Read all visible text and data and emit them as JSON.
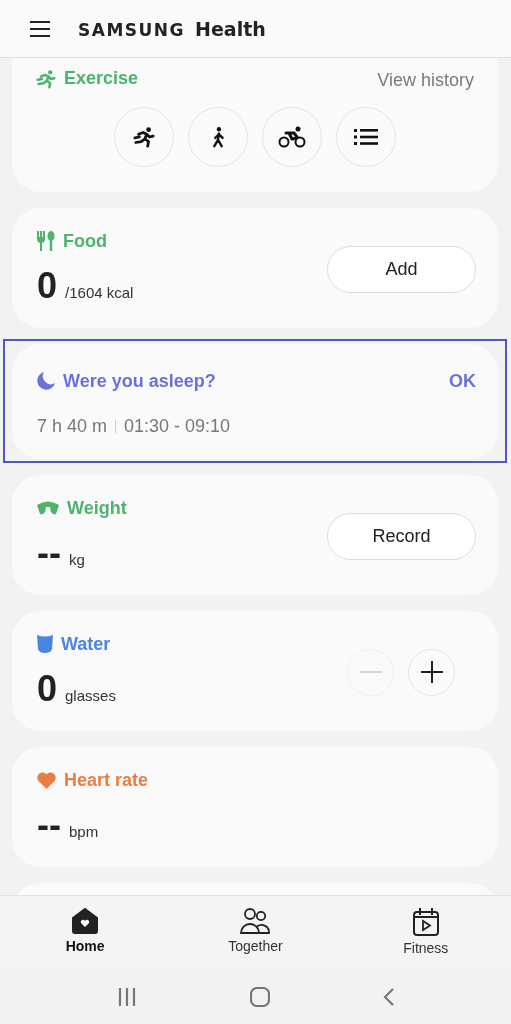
{
  "header": {
    "brand": "SAMSUNG",
    "app": "Health"
  },
  "cards": [
    {
      "kind": "exercise",
      "title": "Exercise",
      "color": "#4cb46c",
      "action": "View history"
    },
    {
      "kind": "food",
      "title": "Food",
      "color": "#4cb46c",
      "value": "0",
      "unit": "/1604 kcal",
      "button": "Add"
    },
    {
      "kind": "sleep",
      "title": "Were you asleep?",
      "color": "#6a72d8",
      "action": "OK",
      "duration": "7 h 40 m",
      "range": "01:30 - 09:10",
      "highlighted": true
    },
    {
      "kind": "weight",
      "title": "Weight",
      "color": "#4cb46c",
      "value": "--",
      "unit": "kg",
      "button": "Record"
    },
    {
      "kind": "water",
      "title": "Water",
      "color": "#4a86e0",
      "value": "0",
      "unit": "glasses",
      "minus_disabled": true
    },
    {
      "kind": "heart",
      "title": "Heart rate",
      "color": "#ea7d45",
      "value": "--",
      "unit": "bpm"
    }
  ],
  "nav": [
    {
      "label": "Home",
      "selected": true
    },
    {
      "label": "Together",
      "selected": false
    },
    {
      "label": "Fitness",
      "selected": false
    }
  ]
}
